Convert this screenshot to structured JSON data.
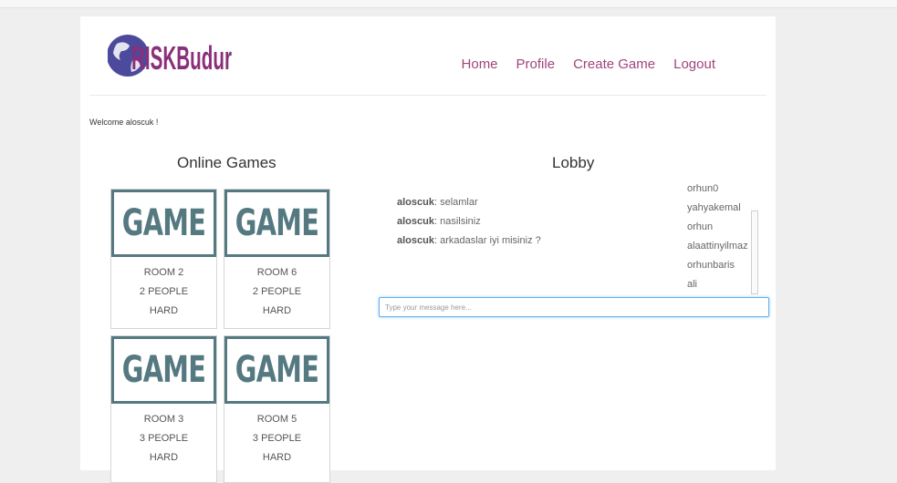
{
  "header": {
    "logo_text": "RISKBudur",
    "nav": [
      {
        "label": "Home"
      },
      {
        "label": "Profile"
      },
      {
        "label": "Create Game"
      },
      {
        "label": "Logout"
      }
    ]
  },
  "welcome": "Welcome aloscuk !",
  "online_games": {
    "title": "Online Games",
    "rooms": [
      {
        "banner": "GAME",
        "room": "ROOM 2",
        "people": "2 PEOPLE",
        "difficulty": "HARD"
      },
      {
        "banner": "GAME",
        "room": "ROOM 6",
        "people": "2 PEOPLE",
        "difficulty": "HARD"
      },
      {
        "banner": "GAME",
        "room": "ROOM 3",
        "people": "3 PEOPLE",
        "difficulty": "HARD"
      },
      {
        "banner": "GAME",
        "room": "ROOM 5",
        "people": "3 PEOPLE",
        "difficulty": "HARD"
      }
    ]
  },
  "lobby": {
    "title": "Lobby",
    "messages": [
      {
        "user": "aloscuk",
        "text": "selamlar"
      },
      {
        "user": "aloscuk",
        "text": "nasilsiniz"
      },
      {
        "user": "aloscuk",
        "text": "arkadaslar iyi misiniz ?"
      }
    ],
    "users": [
      "orhun0",
      "yahyakemal",
      "orhun",
      "alaattinyilmaz",
      "orhunbaris",
      "ali"
    ],
    "input_placeholder": "Type your message here..."
  },
  "colors": {
    "nav": "#a0457c",
    "game_banner": "#557980",
    "logo_purple": "#8a2f7a",
    "logo_globe": "#4b4a9c"
  }
}
